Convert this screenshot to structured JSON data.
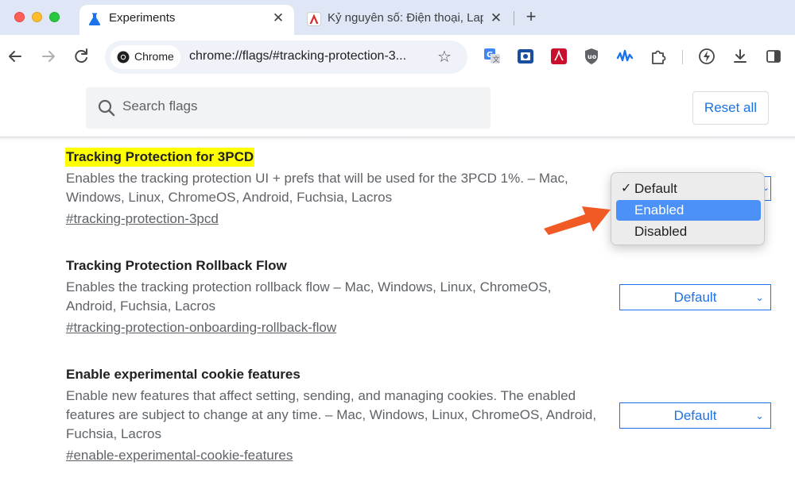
{
  "tabs": [
    {
      "title": "Experiments",
      "icon": "flask-icon",
      "active": true
    },
    {
      "title": "Kỷ nguyên số: Điện thoại, Laptop",
      "icon": "site-logo-icon",
      "active": false
    }
  ],
  "toolbar": {
    "chip_label": "Chrome",
    "url": "chrome://flags/#tracking-protection-3...",
    "extensions": [
      "translate-icon",
      "screen-capture-icon",
      "pdf-icon",
      "ublock-icon",
      "waves-icon",
      "puzzle-icon",
      "performance-icon",
      "download-icon",
      "side-panel-icon"
    ]
  },
  "search": {
    "placeholder": "Search flags",
    "value": ""
  },
  "reset_label": "Reset all",
  "flags": [
    {
      "title": "Tracking Protection for 3PCD",
      "desc_line1": "Enables the tracking protection UI + prefs that will be used for the 3PCD 1%. – Mac,",
      "desc_line2": "Windows, Linux, ChromeOS, Android, Fuchsia, Lacros",
      "link": "#tracking-protection-3pcd",
      "value": "Enabled"
    },
    {
      "title": "Tracking Protection Rollback Flow",
      "desc_line1": "Enables the tracking protection rollback flow – Mac, Windows, Linux, ChromeOS,",
      "desc_line2": "Android, Fuchsia, Lacros",
      "link": "#tracking-protection-onboarding-rollback-flow",
      "value": "Default"
    },
    {
      "title": "Enable experimental cookie features",
      "desc_line1": "Enable new features that affect setting, sending, and managing cookies. The enabled",
      "desc_line2": "features are subject to change at any time. – Mac, Windows, Linux, ChromeOS, Android,",
      "desc_line3": "Fuchsia, Lacros",
      "link": "#enable-experimental-cookie-features",
      "value": "Default"
    }
  ],
  "dropdown": {
    "options": [
      "Default",
      "Enabled",
      "Disabled"
    ],
    "checked": "Default",
    "highlighted": "Enabled",
    "check_mark": "✓"
  },
  "colors": {
    "accent": "#1a73e8",
    "highlight": "#ffff00",
    "arrow": "#f15a24",
    "menu_selection": "#4b91f7"
  }
}
